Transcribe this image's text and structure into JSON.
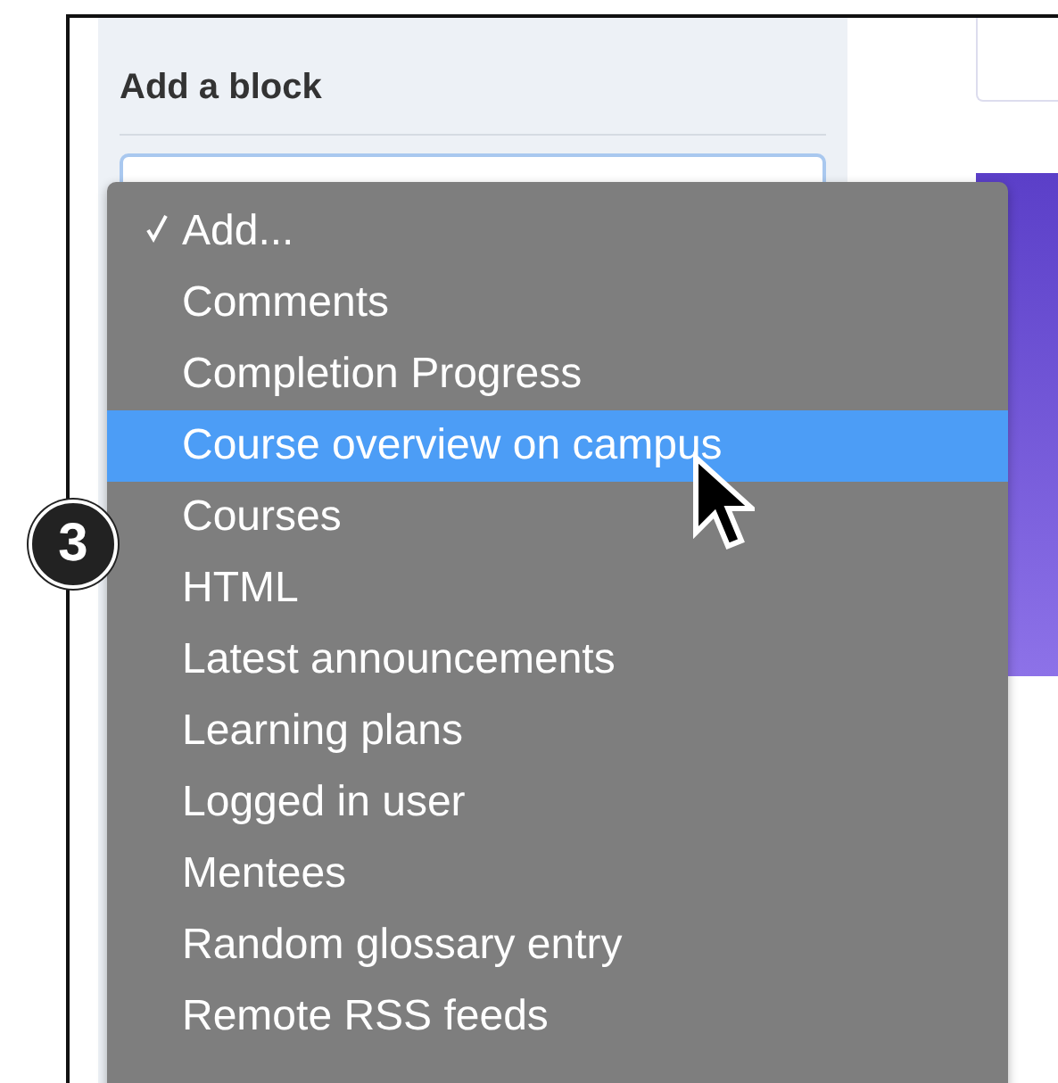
{
  "panel": {
    "title": "Add a block"
  },
  "callout": {
    "label": "3"
  },
  "menu": {
    "items": [
      {
        "label": "Add...",
        "checked": true,
        "selected": false
      },
      {
        "label": "Comments",
        "checked": false,
        "selected": false
      },
      {
        "label": "Completion Progress",
        "checked": false,
        "selected": false
      },
      {
        "label": "Course overview on campus",
        "checked": false,
        "selected": true
      },
      {
        "label": "Courses",
        "checked": false,
        "selected": false
      },
      {
        "label": "HTML",
        "checked": false,
        "selected": false
      },
      {
        "label": "Latest announcements",
        "checked": false,
        "selected": false
      },
      {
        "label": "Learning plans",
        "checked": false,
        "selected": false
      },
      {
        "label": "Logged in user",
        "checked": false,
        "selected": false
      },
      {
        "label": "Mentees",
        "checked": false,
        "selected": false
      },
      {
        "label": "Random glossary entry",
        "checked": false,
        "selected": false
      },
      {
        "label": "Remote RSS feeds",
        "checked": false,
        "selected": false
      }
    ]
  }
}
